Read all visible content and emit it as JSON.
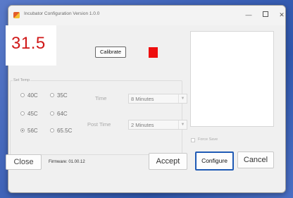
{
  "window": {
    "title": "Incubator Configuration Version 1.0.0",
    "minimize_label": "—",
    "close_label": "✕"
  },
  "display": {
    "value": "31.5"
  },
  "calibrate": {
    "label": "Calibrate"
  },
  "indicator": {
    "color": "#ee0e0e"
  },
  "set_temp": {
    "title": "Set Temp",
    "options": [
      {
        "label": "40C",
        "selected": false
      },
      {
        "label": "35C",
        "selected": false
      },
      {
        "label": "45C",
        "selected": false
      },
      {
        "label": "64C",
        "selected": false
      },
      {
        "label": "56C",
        "selected": true
      },
      {
        "label": "65.5C",
        "selected": false
      }
    ]
  },
  "time": {
    "label": "Time",
    "value": "8 Minutes"
  },
  "post_time": {
    "label": "Post Time",
    "value": "2 Minutes"
  },
  "force_save": {
    "label": "Force Save",
    "checked": false
  },
  "footer": {
    "close_label": "Close",
    "firmware_text": "Firmware: 01.00.12",
    "accept_label": "Accept",
    "configure_label": "Configure",
    "cancel_label": "Cancel"
  }
}
